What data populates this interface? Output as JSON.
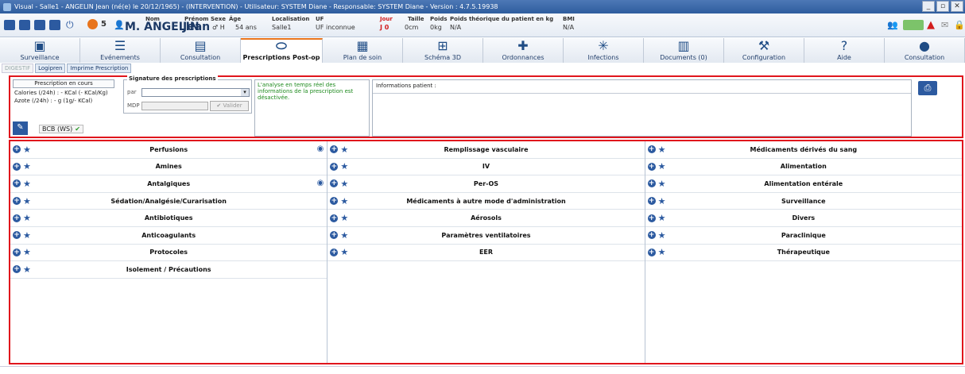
{
  "window": {
    "title": "Visual - Salle1 - ANGELIN Jean (né(e) le 20/12/1965) - (INTERVENTION) - Utilisateur: SYSTEM Diane - Responsable: SYSTEM Diane - Version : 4.7.5.19938",
    "controls": [
      "_",
      "▫",
      "✕"
    ]
  },
  "patient": {
    "counter": "5",
    "name_label": "Nom",
    "name": "M. ANGELIN",
    "firstname_label": "Prénom",
    "firstname": "Jean",
    "sex_label": "Sexe",
    "sex": "♂ H",
    "age_label": "Âge",
    "age": "54 ans",
    "location_label": "Localisation",
    "location": "Salle1",
    "uf_label": "UF",
    "uf": "UF inconnue",
    "jour_label": "Jour",
    "jour": "J 0",
    "height_label": "Taille",
    "height": "0cm",
    "weight_label": "Poids",
    "weight": "0kg",
    "theoretical_weight_label": "Poids théorique du patient en kg",
    "theoretical_weight": "N/A",
    "bmi_label": "BMI",
    "bmi": "N/A"
  },
  "tabs": [
    {
      "label": "Surveillance",
      "icon": "monitor-icon"
    },
    {
      "label": "Evénements",
      "icon": "list-icon"
    },
    {
      "label": "Consultation",
      "icon": "clipboard-icon"
    },
    {
      "label": "Prescriptions Post-op",
      "icon": "pill-icon",
      "active": true
    },
    {
      "label": "Plan de soin",
      "icon": "grid-icon"
    },
    {
      "label": "Schéma 3D",
      "icon": "body-icon"
    },
    {
      "label": "Ordonnances",
      "icon": "medical-cross-icon"
    },
    {
      "label": "Infections",
      "icon": "virus-icon"
    },
    {
      "label": "Documents (0)",
      "icon": "documents-icon"
    },
    {
      "label": "Configuration",
      "icon": "wrench-icon"
    },
    {
      "label": "Aide",
      "icon": "help-icon"
    },
    {
      "label": "Consultation",
      "icon": "person-icon"
    }
  ],
  "subtabs": [
    "DIGESTIF",
    "Logipren",
    "Imprime Prescription"
  ],
  "prescription": {
    "title": "Prescription en cours",
    "calories": "Calories (/24h) : - KCal (- KCal/Kg)",
    "azote": "Azote (/24h) : - g (1g/- KCal)",
    "bcb": "BCB (WS)"
  },
  "signature": {
    "title": "Signature des prescriptions",
    "par_label": "par",
    "mdp_label": "MDP",
    "valider": "Valider"
  },
  "analyse_text": "L'analyse en temps réel des informations de la prescription est désactivée.",
  "info_patient_label": "Informations patient :",
  "categories": {
    "col1": [
      {
        "label": "Perfusions",
        "eye": true
      },
      {
        "label": "Amines"
      },
      {
        "label": "Antalgiques",
        "eye": true
      },
      {
        "label": "Sédation/Analgésie/Curarisation"
      },
      {
        "label": "Antibiotiques"
      },
      {
        "label": "Anticoagulants"
      },
      {
        "label": "Protocoles"
      },
      {
        "label": "Isolement / Précautions"
      }
    ],
    "col2": [
      {
        "label": "Remplissage vasculaire"
      },
      {
        "label": "IV"
      },
      {
        "label": "Per-OS"
      },
      {
        "label": "Médicaments à autre mode d'administration"
      },
      {
        "label": "Aérosols"
      },
      {
        "label": "Paramètres ventilatoires"
      },
      {
        "label": "EER"
      }
    ],
    "col3": [
      {
        "label": "Médicaments dérivés du sang"
      },
      {
        "label": "Alimentation"
      },
      {
        "label": "Alimentation entérale"
      },
      {
        "label": "Surveillance"
      },
      {
        "label": "Divers"
      },
      {
        "label": "Paraclinique"
      },
      {
        "label": "Thérapeutique"
      }
    ]
  },
  "colors": {
    "accent": "#2c5aa0",
    "highlight_border": "#e0151c",
    "active_tab_marker": "#e8741c",
    "analysis_text": "#1e8a1e"
  }
}
